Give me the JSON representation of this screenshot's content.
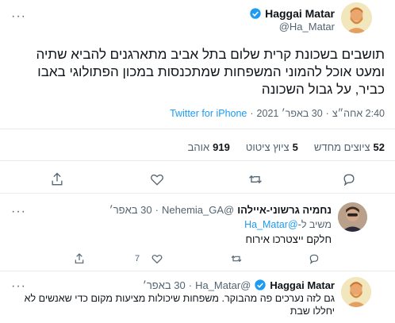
{
  "main_tweet": {
    "author_name": "Haggai Matar",
    "author_handle": "@Ha_Matar",
    "text": "תושבים בשכונת קרית שלום בתל אביב מתארגנים להביא שתיה ומעט אוכל להמוני המשפחות שמתכנסות במכון הפתולוגי באבו כביר, על גבול השכונה",
    "time": "2:40 אחה״צ",
    "date": "30 באפר׳ 2021",
    "source": "Twitter for iPhone",
    "stats": {
      "retweets_value": "52",
      "retweets_label": "ציוצים מחדש",
      "quotes_value": "5",
      "quotes_label": "ציוץ ציטוט",
      "likes_value": "919",
      "likes_label": "אוהב"
    }
  },
  "reply_1": {
    "author_name": "נחמיה גרשוני-איילהו",
    "author_handle": "@Nehemia_GA",
    "time": "30 באפר׳",
    "replying_prefix": "משיב ל-",
    "replying_to": "@Ha_Matar",
    "text": "חלקם ייצטרכו אירוח",
    "like_count": "7"
  },
  "reply_2": {
    "author_name": "Haggai Matar",
    "author_handle": "@Ha_Matar",
    "time": "30 באפר׳",
    "text": "גם לזה נערכים פה מהבוקר. משפחות שיכולות מציעות מקום כדי שאנשים לא יחללו שבת"
  },
  "icons": {
    "verified": "verified-badge-icon",
    "reply": "reply-icon",
    "retweet": "retweet-icon",
    "like": "heart-icon",
    "share": "share-icon",
    "more": "more-dots-icon"
  },
  "colors": {
    "accent": "#1d9bf0",
    "muted": "#536471",
    "divider": "#e6ecf0"
  }
}
